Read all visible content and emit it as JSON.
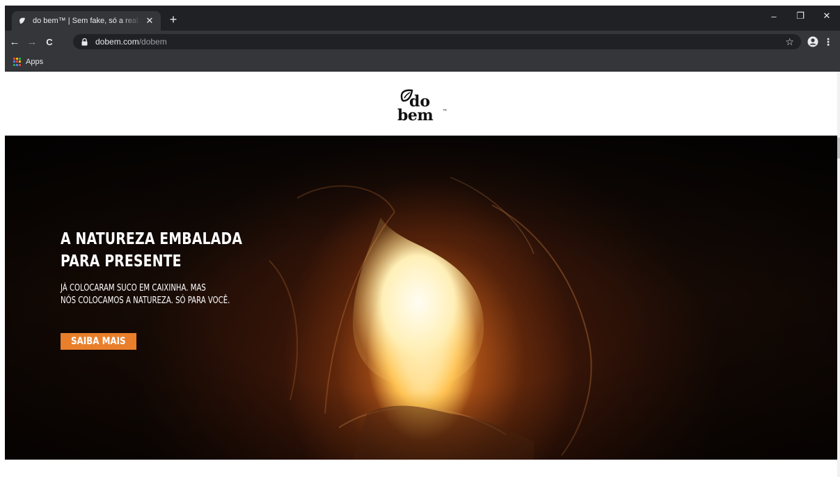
{
  "browser": {
    "tab": {
      "title": "do bem™ | Sem fake, só a real. Só",
      "favicon": "dobem-leaf-icon",
      "close_label": "✕"
    },
    "new_tab_label": "+",
    "window_controls": {
      "minimize": "–",
      "restore": "❐",
      "close": "✕"
    },
    "toolbar": {
      "back": "←",
      "forward": "→",
      "reload": "C",
      "url_host": "dobem.com",
      "url_path": "/dobem",
      "star": "☆",
      "profile": "profile-icon",
      "menu": "⋮"
    },
    "bookmarks": {
      "apps_label": "Apps"
    }
  },
  "site": {
    "logo": {
      "line1": "do",
      "line2": "bem",
      "tm": "™"
    },
    "hero": {
      "title_line1": "A NATUREZA EMBALADA",
      "title_line2": "PARA PRESENTE",
      "sub_line1": "JÁ COLOCARAM SUCO EM CAIXINHA. MAS",
      "sub_line2": "NÓS COLOCAMOS A NATUREZA. SÓ PARA VOCÊ.",
      "cta_label": "SAIBA MAIS"
    }
  },
  "colors": {
    "tabstrip": "#202124",
    "toolbar": "#35363a",
    "cta": "#e97f2b",
    "hero_glow": "#ffc252"
  }
}
